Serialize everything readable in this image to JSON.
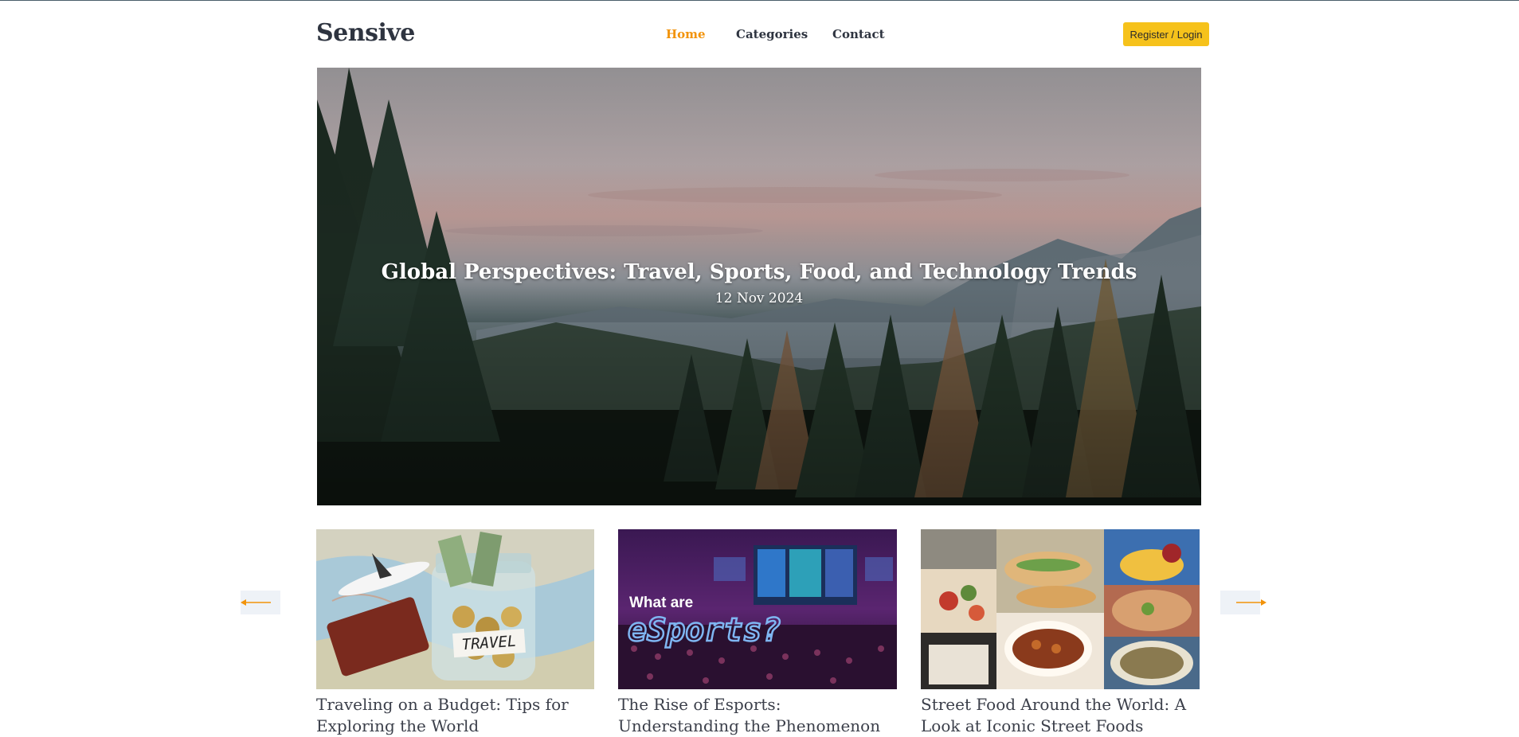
{
  "header": {
    "logo": "Sensive",
    "nav": [
      "Home",
      "Categories",
      "Contact"
    ],
    "register_label": "Register / Login"
  },
  "hero": {
    "title": "Global Perspectives: Travel, Sports, Food, and Technology Trends",
    "date": "12 Nov 2024"
  },
  "cards": [
    {
      "title": "Traveling on a Budget: Tips for Exploring the World",
      "image_text": "TRAVEL"
    },
    {
      "title": "The Rise of Esports: Understanding the Phenomenon",
      "image_text_top": "What are",
      "image_text_main": "eSports?"
    },
    {
      "title": "Street Food Around the World: A Look at Iconic Street Foods"
    }
  ],
  "colors": {
    "accent": "#f2930a",
    "button": "#f6c21b"
  },
  "icons": {
    "prev": "arrow-left-icon",
    "next": "arrow-right-icon"
  }
}
